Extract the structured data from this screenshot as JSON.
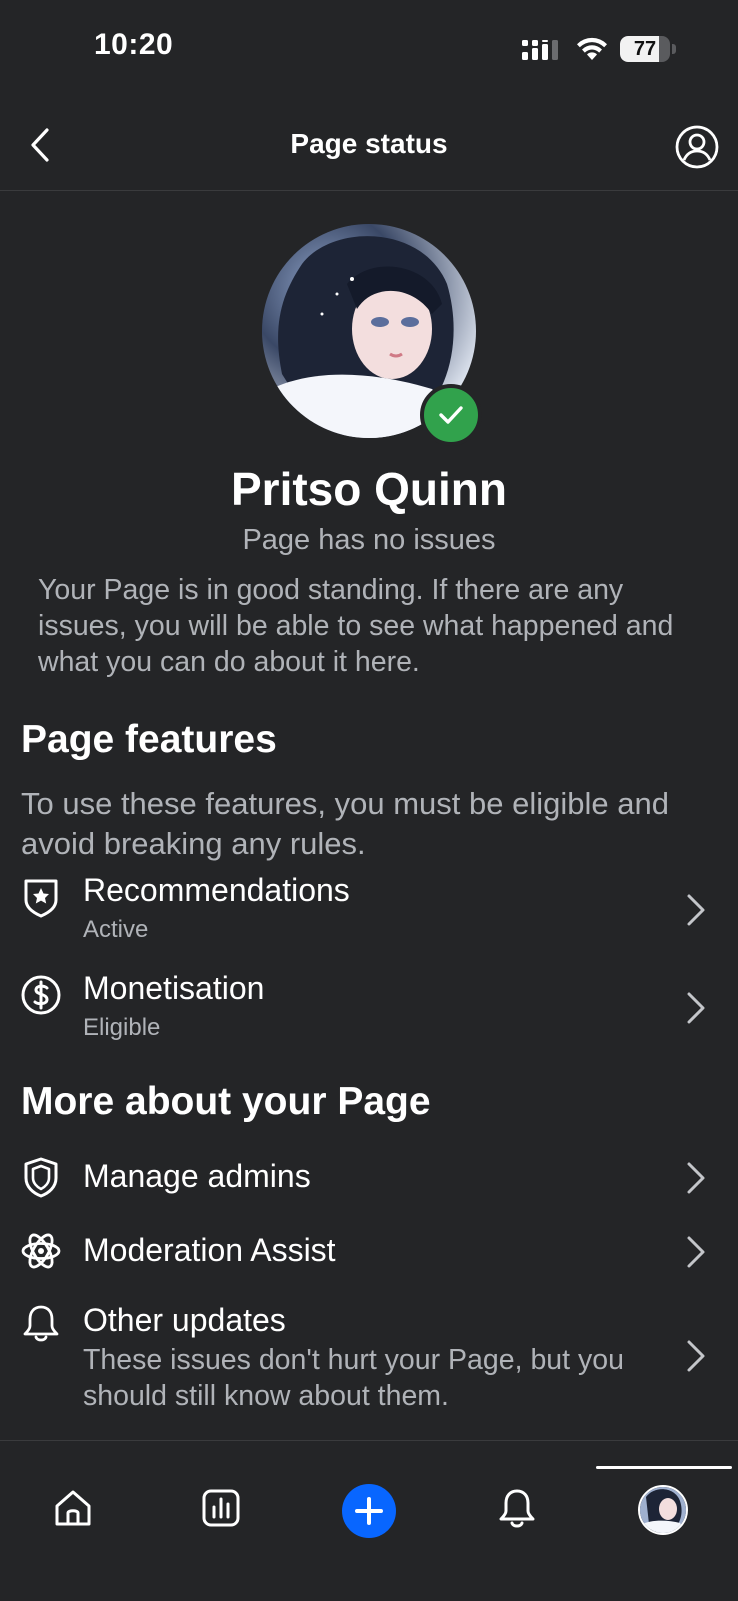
{
  "status_bar": {
    "time": "10:20",
    "battery": "77",
    "battery_level": 0.77
  },
  "header": {
    "title": "Page status",
    "back_icon": "chevron-left-icon",
    "profile_icon": "user-circle-icon"
  },
  "profile": {
    "name": "Pritso Quinn",
    "status": "Page has no issues",
    "description": "Your Page is in good standing. If there are any issues, you will be able to see what happened and what you can do about it here.",
    "badge_icon": "check-icon",
    "badge_color": "#31a24c"
  },
  "features": {
    "heading": "Page features",
    "subheading": "To use these features, you must be eligible and avoid breaking any rules.",
    "items": [
      {
        "label": "Recommendations",
        "status": "Active",
        "icon": "shield-star-icon"
      },
      {
        "label": "Monetisation",
        "status": "Eligible",
        "icon": "dollar-circle-icon"
      }
    ]
  },
  "more": {
    "heading": "More about your Page",
    "items": [
      {
        "label": "Manage admins",
        "icon": "shield-icon"
      },
      {
        "label": "Moderation Assist",
        "icon": "atom-icon"
      },
      {
        "label": "Other updates",
        "description": "These issues don't hurt your Page, but you should still know about them.",
        "icon": "bell-icon"
      }
    ]
  },
  "bottom_nav": {
    "items": [
      "home-icon",
      "insights-icon",
      "create-icon",
      "notifications-icon",
      "profile-avatar"
    ],
    "active": "profile-avatar",
    "accent": "#0866ff"
  }
}
